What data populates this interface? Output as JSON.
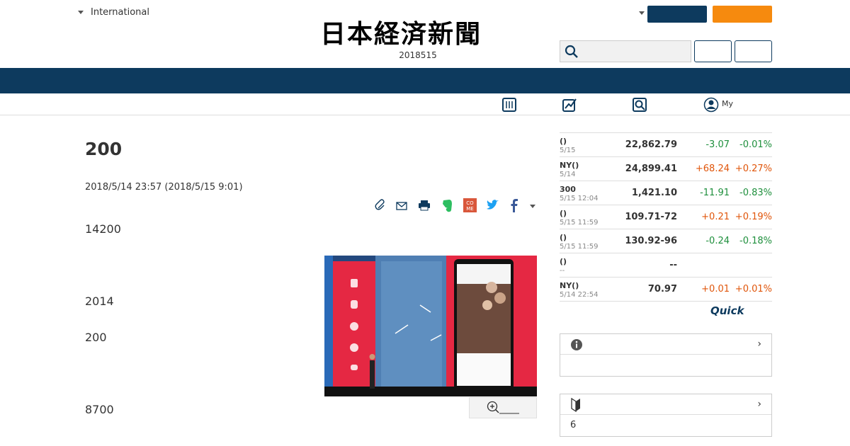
{
  "header": {
    "edition_label": "International",
    "logo_text": "日本経済新聞",
    "date": "2018515"
  },
  "subnav": {
    "my_label": "My"
  },
  "article": {
    "headline": "200",
    "date": "2018/5/14 23:57 (2018/5/15 9:01)",
    "paragraphs": [
      "14200",
      "2014",
      "200",
      "8700"
    ]
  },
  "market": {
    "rows": [
      {
        "name": "()",
        "time": "5/15",
        "value": "22,862.79",
        "change": "-3.07",
        "pct": "-0.01%"
      },
      {
        "name": "NY()",
        "time": "5/14",
        "value": "24,899.41",
        "change": "+68.24",
        "pct": "+0.27%"
      },
      {
        "name": "300",
        "time": "5/15 12:04",
        "value": "1,421.10",
        "change": "-11.91",
        "pct": "-0.83%"
      },
      {
        "name": "()",
        "time": "5/15 11:59",
        "value": "109.71-72",
        "change": "+0.21",
        "pct": "+0.19%"
      },
      {
        "name": "()",
        "time": "5/15 11:59",
        "value": "130.92-96",
        "change": "-0.24",
        "pct": "-0.18%"
      },
      {
        "name": "()",
        "time": "--",
        "value": "--",
        "change": "",
        "pct": ""
      },
      {
        "name": "NY()",
        "time": "5/14 22:54",
        "value": "70.97",
        "change": "+0.01",
        "pct": "+0.01%"
      }
    ],
    "quick_label": "Quick"
  },
  "cards": {
    "second_body": "6"
  },
  "colors": {
    "navy": "#0d3a5e",
    "orange": "#f68a0e",
    "up": "#e0550a",
    "down": "#1e8f3c"
  },
  "icons": [
    "search-icon",
    "newspaper-icon",
    "chart-icon",
    "magnifier-icon",
    "user-icon",
    "clip-icon",
    "mail-icon",
    "print-icon",
    "evernote-icon",
    "come-icon",
    "twitter-icon",
    "facebook-icon",
    "zoom-icon",
    "info-icon",
    "beginner-icon"
  ]
}
